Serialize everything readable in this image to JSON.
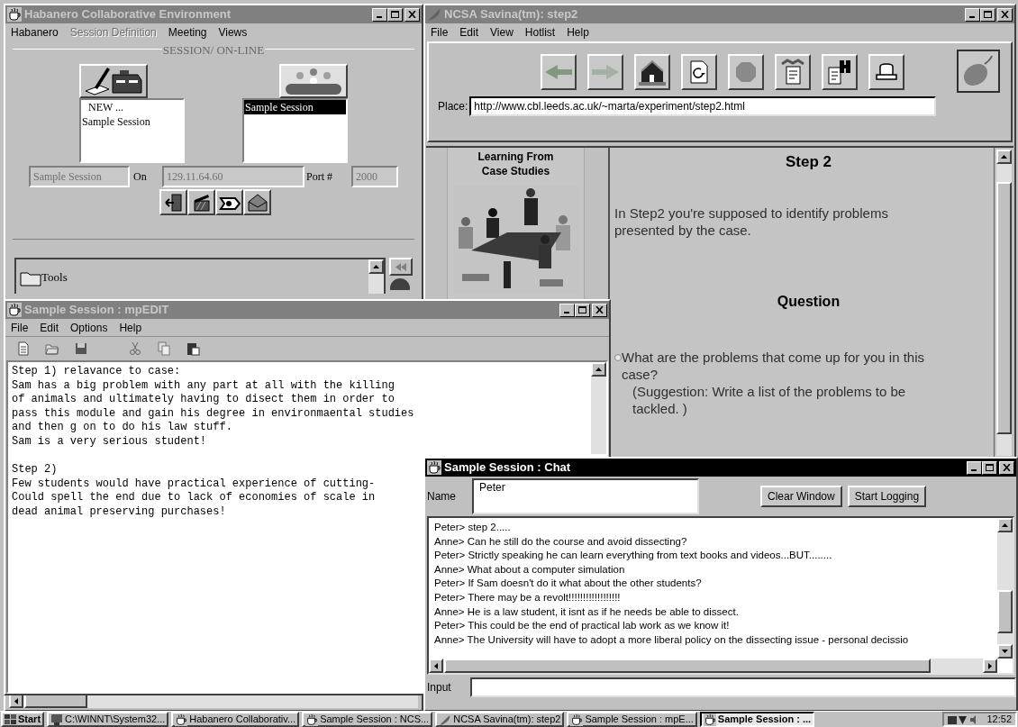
{
  "habanero_window": {
    "title": "Habanero Collaborative Environment",
    "active": false,
    "menu": [
      {
        "label": "Habanero",
        "disabled": false
      },
      {
        "label": "Session Definition",
        "disabled": true
      },
      {
        "label": "Meeting",
        "disabled": false
      },
      {
        "label": "Views",
        "disabled": false
      }
    ],
    "group_title": "SESSION/ ON-LINE",
    "new_sessions": [
      {
        "label": "NEW ...",
        "selected": false
      },
      {
        "label": "Sample Session",
        "selected": false
      }
    ],
    "online_sessions": [
      {
        "label": "Sample Session",
        "selected": true
      }
    ],
    "session_field": {
      "value": "Sample Session",
      "disabled": true
    },
    "on_label": "On",
    "host_field": {
      "value": "129.11.64.60",
      "disabled": true
    },
    "port_label": "Port #",
    "port_field": {
      "value": "2000",
      "disabled": true
    },
    "tree": [
      {
        "label": "Tools"
      }
    ]
  },
  "browser_window": {
    "title": "NCSA Savina(tm): step2",
    "active": false,
    "menu": [
      "File",
      "Edit",
      "View",
      "Hotlist",
      "Help"
    ],
    "toolbar": [
      {
        "kind": "back",
        "disabled": false
      },
      {
        "kind": "forward",
        "disabled": true
      },
      {
        "kind": "home",
        "disabled": false
      },
      {
        "kind": "reload",
        "disabled": false
      },
      {
        "kind": "stop",
        "disabled": false
      },
      {
        "kind": "hotlist",
        "disabled": false
      },
      {
        "kind": "find",
        "disabled": false
      },
      {
        "kind": "print",
        "disabled": false
      }
    ],
    "place_label": "Place:",
    "url": "http://www.cbl.leeds.ac.uk/~marta/experiment/step2.html",
    "side_title": "Learning From Case Studies",
    "heading": "Step 2",
    "intro": "In Step2 you're supposed to identify problems presented by the case.",
    "question_heading": "Question",
    "question": "What are the problems that come up for you in this case?",
    "suggestion": "(Suggestion: Write a list of the problems to be tackled. )"
  },
  "editor_window": {
    "title": "Sample Session : mpEDIT",
    "active": false,
    "menu": [
      "File",
      "Edit",
      "Options",
      "Help"
    ],
    "text": "Step 1) relavance to case:\nSam has a big problem with any part at all with the killing\nof animals and ultimately having to disect them in order to\npass this module and gain his degree in environmaental studies\nand then g on to do his law stuff.\nSam is a very serious student!\n\nStep 2)\nFew students would have practical experience of cutting-\nCould spell the end due to lack of economies of scale in\ndead animal preserving purchases!"
  },
  "chat_window": {
    "title": "Sample Session : Chat",
    "active": true,
    "name_label": "Name",
    "name_field": {
      "value": "Peter"
    },
    "buttons": [
      "Clear Window",
      "Start Logging"
    ],
    "messages": [
      "Peter> step 2.....",
      "Anne> Can he still do the course and avoid dissecting?",
      "Peter> Strictly speaking he can learn everything from text books and videos...BUT........",
      "Anne> What about a computer simulation",
      "Peter> If Sam doesn't do it what about the other students?",
      "Peter> There may be a revolt!!!!!!!!!!!!!!!!!!",
      "Anne> He is a law student, it isnt as if he needs be able to dissect.",
      "Peter> This could be the end of practical lab work as we know it!",
      "Anne> The University will have to adopt a more liberal policy on the dissecting issue - personal decissio"
    ],
    "input_label": "Input"
  },
  "taskbar": {
    "start": "Start",
    "tasks": [
      {
        "label": "C:\\WINNT\\System32...",
        "kind": "console",
        "selected": false
      },
      {
        "label": "Habanero Collaborativ...",
        "kind": "app",
        "selected": false
      },
      {
        "label": "Sample Session : NCS...",
        "kind": "app",
        "selected": false
      },
      {
        "label": "NCSA Savina(tm): step2",
        "kind": "browser",
        "selected": false
      },
      {
        "label": "Sample Session : mpE...",
        "kind": "app",
        "selected": false
      },
      {
        "label": "Sample Session : ...",
        "kind": "app",
        "selected": true
      }
    ],
    "clock": "12:52"
  }
}
